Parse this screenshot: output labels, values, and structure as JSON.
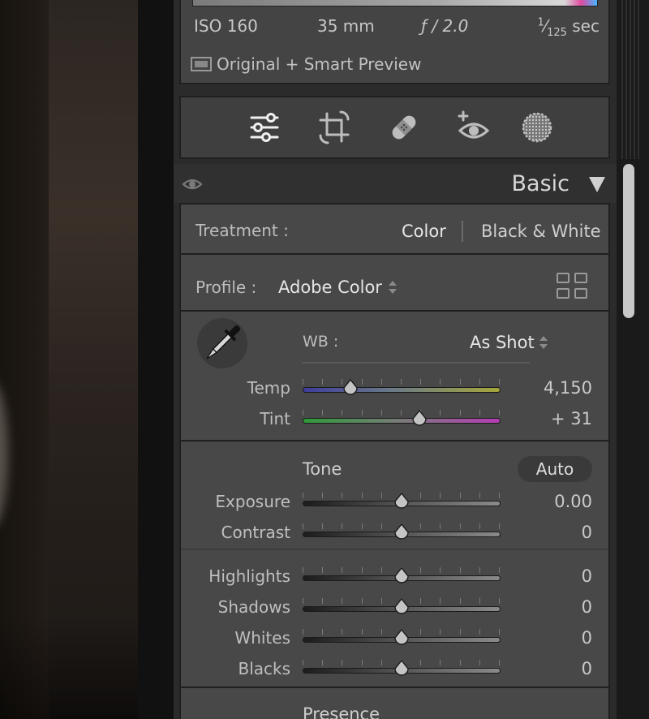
{
  "info": {
    "iso": "ISO 160",
    "focal": "35 mm",
    "aperture": "ƒ / 2.0",
    "shutter_num": "1",
    "shutter_den": "125",
    "shutter_unit": "sec",
    "preview": "Original + Smart Preview"
  },
  "tools": [
    "edit-sliders-icon",
    "crop-icon",
    "healing-icon",
    "red-eye-icon",
    "masking-icon"
  ],
  "section": {
    "title": "Basic"
  },
  "treatment": {
    "label": "Treatment :",
    "options": [
      "Color",
      "Black & White"
    ],
    "selected": "Color"
  },
  "profile": {
    "label": "Profile :",
    "value": "Adobe Color"
  },
  "wb": {
    "label": "WB :",
    "value": "As Shot",
    "sliders": [
      {
        "label": "Temp",
        "value": "4,150",
        "position": 0.24
      },
      {
        "label": "Tint",
        "value": "+ 31",
        "position": 0.59
      }
    ]
  },
  "tone": {
    "title": "Tone",
    "auto": "Auto",
    "sliders": [
      {
        "label": "Exposure",
        "value": "0.00",
        "position": 0.5
      },
      {
        "label": "Contrast",
        "value": "0",
        "position": 0.5
      },
      {
        "label": "Highlights",
        "value": "0",
        "position": 0.5
      },
      {
        "label": "Shadows",
        "value": "0",
        "position": 0.5
      },
      {
        "label": "Whites",
        "value": "0",
        "position": 0.5
      },
      {
        "label": "Blacks",
        "value": "0",
        "position": 0.5
      }
    ]
  },
  "presence": {
    "title": "Presence"
  }
}
